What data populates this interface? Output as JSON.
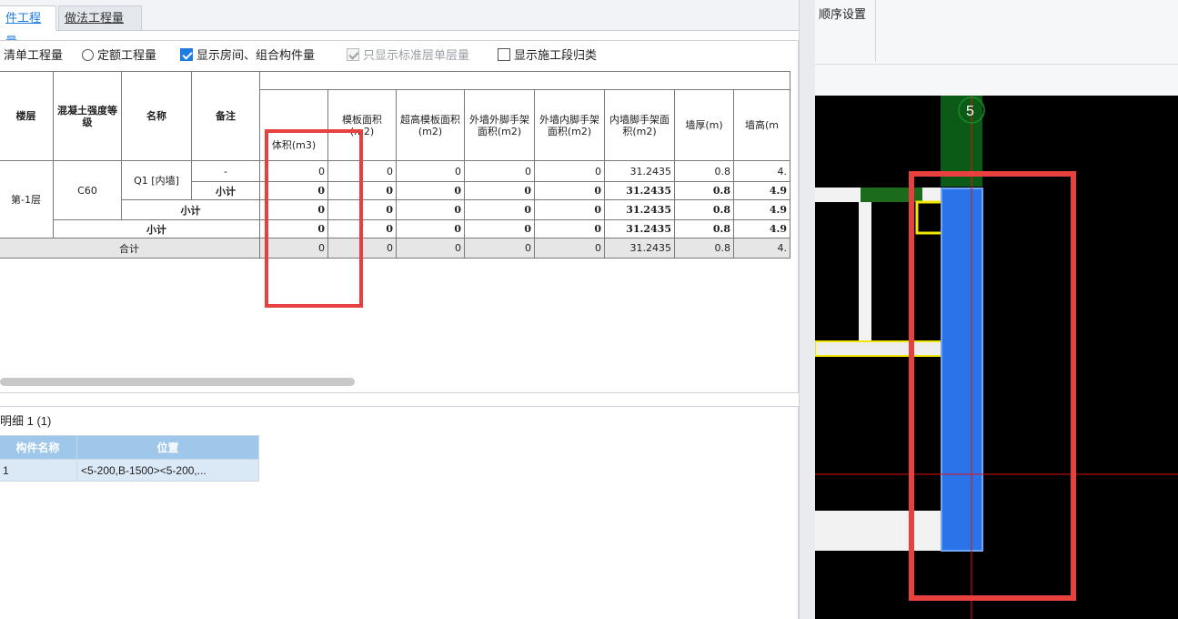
{
  "tabs": [
    {
      "label": "件工程量",
      "active": true
    },
    {
      "label": "做法工程量",
      "active": false
    }
  ],
  "options": {
    "list_qty": "清单工程量",
    "quota_qty": "定额工程量",
    "show_rooms": "显示房间、组合构件量",
    "only_std_floor": "只显示标准层单层量",
    "show_stage": "显示施工段归类"
  },
  "table": {
    "headers": {
      "floor": "楼层",
      "grade": "混凝土强度等级",
      "name": "名称",
      "remark": "备注",
      "volume": "体积(m3)",
      "formwork": "模板面积(m2)",
      "high_formwork": "超高模板面积(m2)",
      "ext_outer_scaffold": "外墙外脚手架面积(m2)",
      "ext_inner_scaffold": "外墙内脚手架面积(m2)",
      "int_scaffold": "内墙脚手架面积(m2)",
      "thickness": "墙厚(m)",
      "height": "墙高(m"
    },
    "floor": "第-1层",
    "grade": "C60",
    "name": "Q1 [内墙]",
    "dash": "-",
    "subtotal": "小计",
    "total": "合计",
    "rows": [
      [
        "0",
        "0",
        "0",
        "0",
        "0",
        "31.2435",
        "0.8",
        "4."
      ],
      [
        "0",
        "0",
        "0",
        "0",
        "0",
        "31.2435",
        "0.8",
        "4.9"
      ],
      [
        "0",
        "0",
        "0",
        "0",
        "0",
        "31.2435",
        "0.8",
        "4.9"
      ],
      [
        "0",
        "0",
        "0",
        "0",
        "0",
        "31.2435",
        "0.8",
        "4.9"
      ],
      [
        "0",
        "0",
        "0",
        "0",
        "0",
        "31.2435",
        "0.8",
        "4."
      ]
    ]
  },
  "detail": {
    "title": "明细 1 (1)",
    "col_name": "构件名称",
    "col_pos": "位置",
    "row_name": "1",
    "row_pos": "<5-200,B-1500><5-200,..."
  },
  "right_top": {
    "order_setting": "顺序设置"
  },
  "canvas": {
    "axis_label": "5",
    "colors": {
      "background": "#000000",
      "selected_wall": "#2a73e8",
      "axis_band": "#0b5a16",
      "highlight": "#e8403e",
      "yellow_edge": "#f2e600"
    }
  }
}
